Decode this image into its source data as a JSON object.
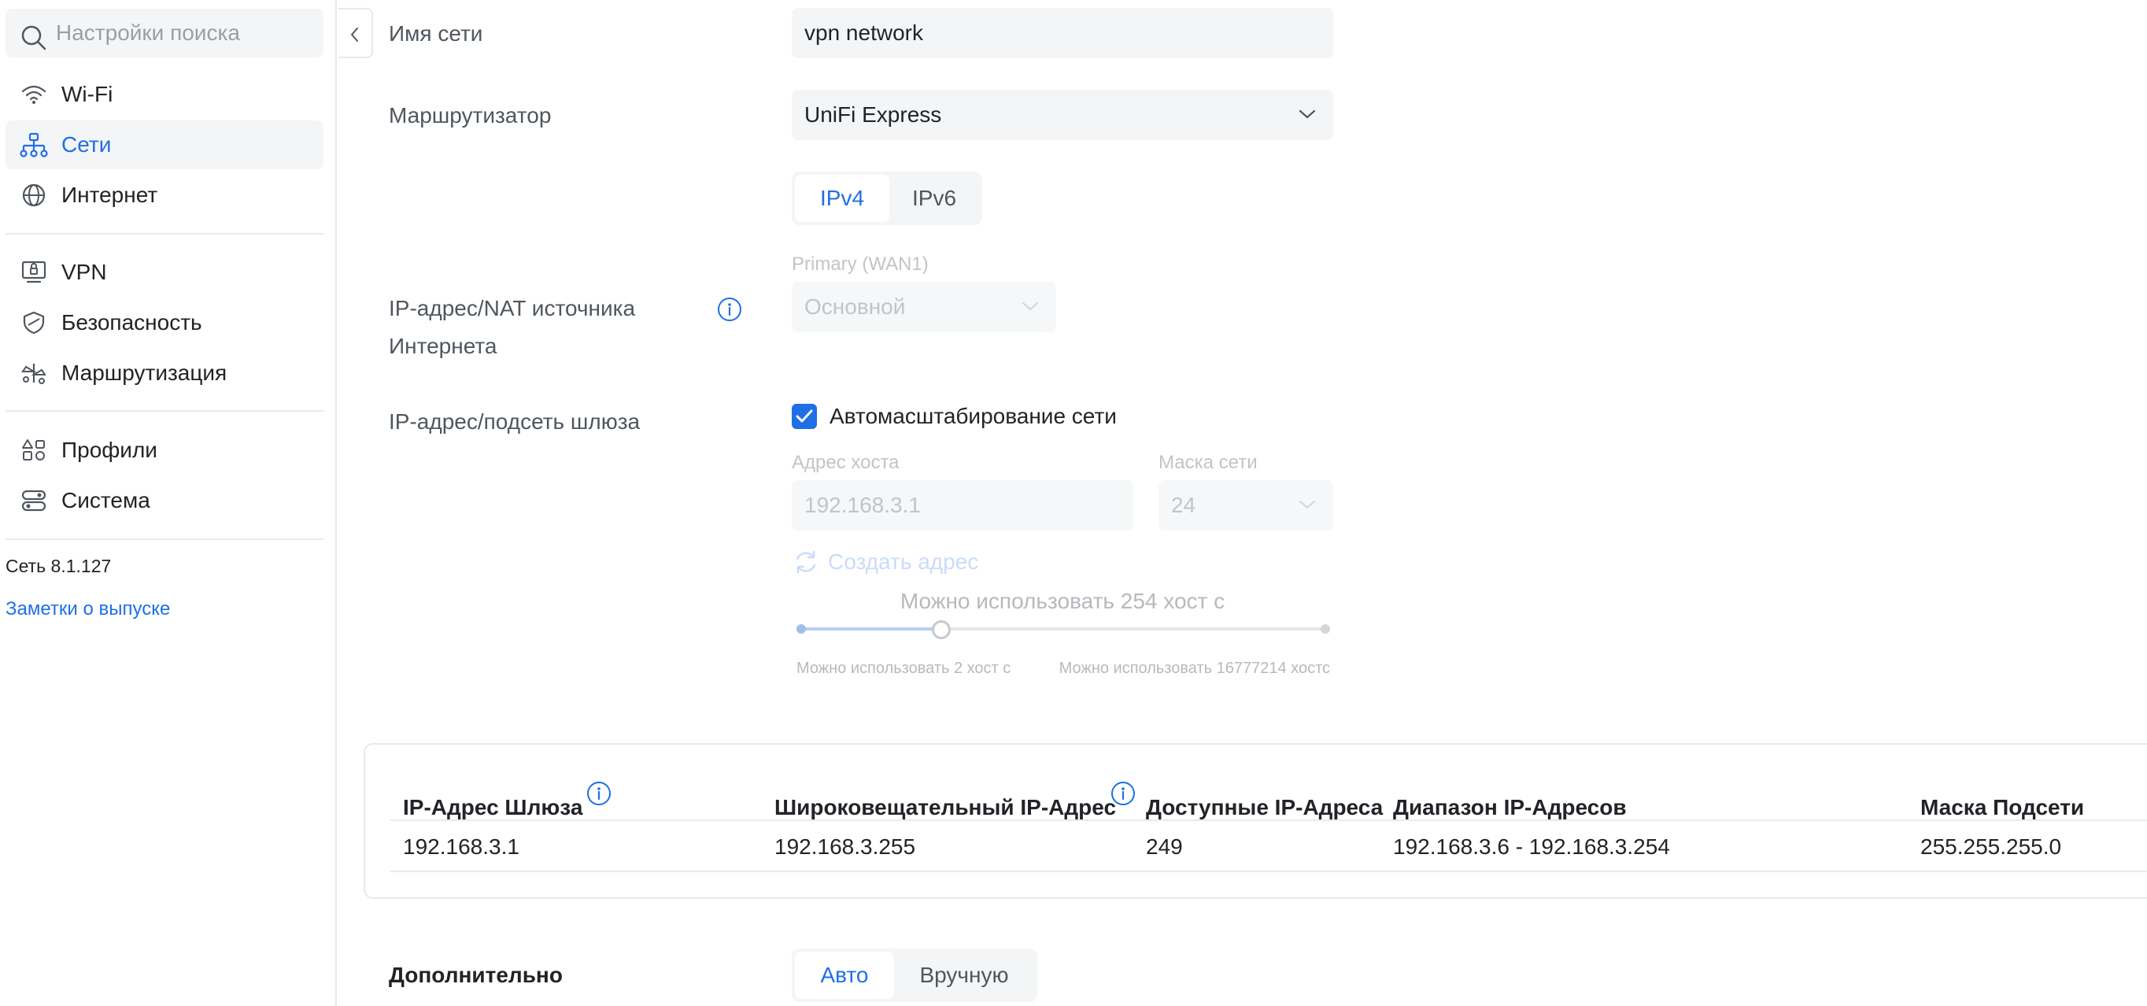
{
  "sidebar": {
    "search_placeholder": "Настройки поиска",
    "items": [
      {
        "label": "Wi-Fi",
        "icon": "wifi-icon"
      },
      {
        "label": "Сети",
        "icon": "network-tree-icon",
        "active": true
      },
      {
        "label": "Интернет",
        "icon": "globe-icon"
      },
      {
        "label": "VPN",
        "icon": "vpn-icon"
      },
      {
        "label": "Безопасность",
        "icon": "shield-icon"
      },
      {
        "label": "Маршрутизация",
        "icon": "routing-icon"
      },
      {
        "label": "Профили",
        "icon": "profiles-icon"
      },
      {
        "label": "Система",
        "icon": "system-icon"
      }
    ],
    "version": "Сеть 8.1.127",
    "release_notes": "Заметки о выпуске"
  },
  "form": {
    "network_name_label": "Имя сети",
    "network_name_value": "vpn network",
    "router_label": "Маршрутизатор",
    "router_value": "UniFi Express",
    "ip_versions": [
      "IPv4",
      "IPv6"
    ],
    "ip_version_selected": "IPv4",
    "nat_label": "IP-адрес/NAT источника Интернета",
    "wan_label": "Primary (WAN1)",
    "wan_value": "Основной",
    "gateway_label": "IP-адрес/подсеть шлюза",
    "autoscale_label": "Автомасштабирование сети",
    "autoscale_checked": true,
    "host_address_label": "Адрес хоста",
    "host_address_value": "192.168.3.1",
    "netmask_label": "Маска сети",
    "netmask_value": "24",
    "create_address_label": "Создать адрес",
    "slider_title": "Можно использовать 254 хост с",
    "slider_min_label": "Можно использовать 2 хост с",
    "slider_max_label": "Можно использовать 16777214 хостс",
    "slider_level": 0.27,
    "advanced_label": "Дополнительно",
    "advanced_modes": [
      "Авто",
      "Вручную"
    ],
    "advanced_selected": "Авто"
  },
  "summary": {
    "headers": [
      "IP-Адрес Шлюза",
      "Широковещательный IP-Адрес",
      "Доступные IP-Адреса",
      "Диапазон IP-Адресов",
      "Маска Подсети"
    ],
    "values": [
      "192.168.3.1",
      "192.168.3.255",
      "249",
      "192.168.3.6 - 192.168.3.254",
      "255.255.255.0"
    ]
  },
  "colors": {
    "accent": "#1f6fe6",
    "text": "#212327",
    "muted": "#50565e",
    "disabled": "#c2c4c8",
    "field_bg": "#f4f5f6"
  }
}
